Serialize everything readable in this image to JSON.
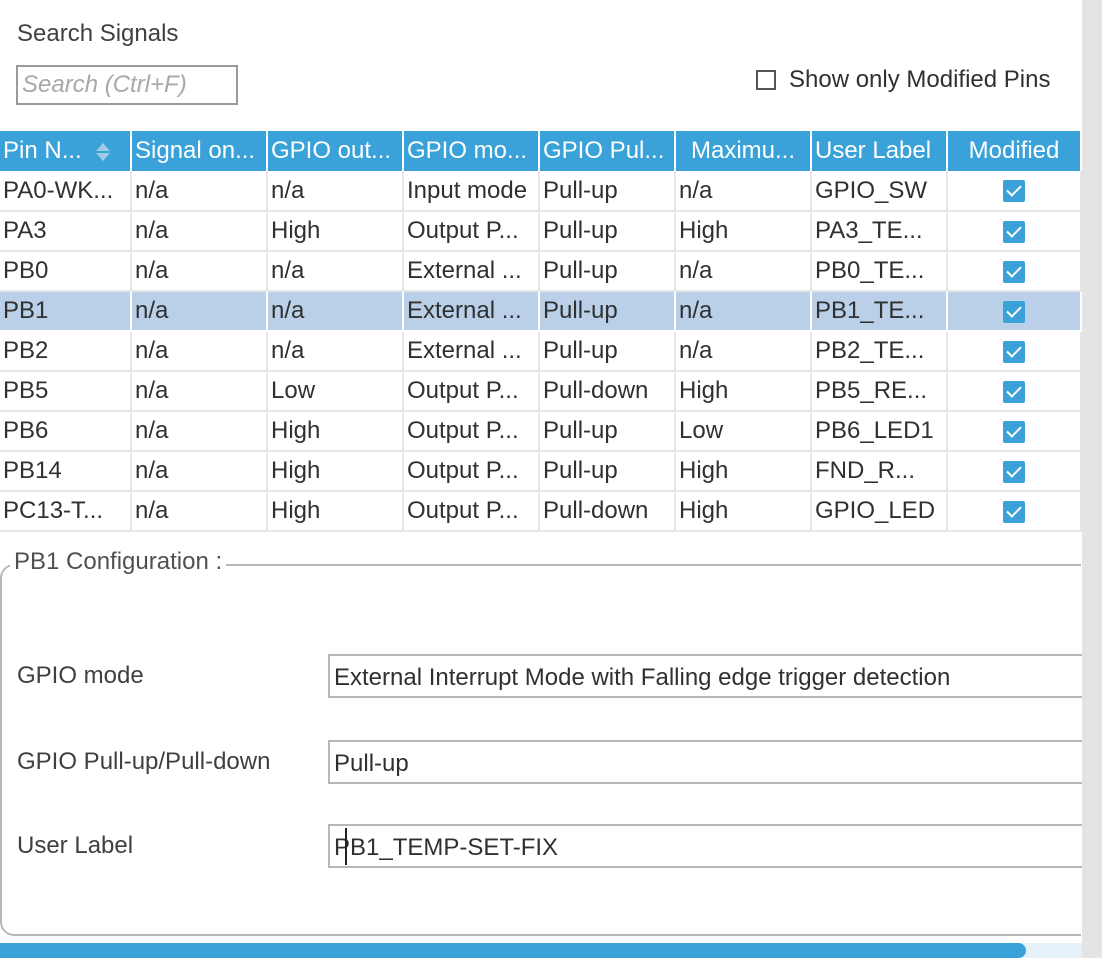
{
  "search": {
    "title": "Search Signals",
    "placeholder": "Search (Ctrl+F)"
  },
  "filter": {
    "show_modified_label": "Show only Modified Pins",
    "checked": false
  },
  "table": {
    "columns": [
      "Pin N...",
      "Signal on...",
      "GPIO out...",
      "GPIO mo...",
      "GPIO Pul...",
      "Maximu...",
      "User Label",
      "Modified"
    ],
    "sorted_column": "Pin N...",
    "selected_row": "PB1",
    "rows": [
      {
        "pin": "PA0-WK...",
        "signal": "n/a",
        "output": "n/a",
        "mode": "Input mode",
        "pull": "Pull-up",
        "max": "n/a",
        "label": "GPIO_SW",
        "modified": true
      },
      {
        "pin": "PA3",
        "signal": "n/a",
        "output": "High",
        "mode": "Output P...",
        "pull": "Pull-up",
        "max": "High",
        "label": "PA3_TE...",
        "modified": true
      },
      {
        "pin": "PB0",
        "signal": "n/a",
        "output": "n/a",
        "mode": "External ...",
        "pull": "Pull-up",
        "max": "n/a",
        "label": "PB0_TE...",
        "modified": true
      },
      {
        "pin": "PB1",
        "signal": "n/a",
        "output": "n/a",
        "mode": "External ...",
        "pull": "Pull-up",
        "max": "n/a",
        "label": "PB1_TE...",
        "modified": true
      },
      {
        "pin": "PB2",
        "signal": "n/a",
        "output": "n/a",
        "mode": "External ...",
        "pull": "Pull-up",
        "max": "n/a",
        "label": "PB2_TE...",
        "modified": true
      },
      {
        "pin": "PB5",
        "signal": "n/a",
        "output": "Low",
        "mode": "Output P...",
        "pull": "Pull-down",
        "max": "High",
        "label": "PB5_RE...",
        "modified": true
      },
      {
        "pin": "PB6",
        "signal": "n/a",
        "output": "High",
        "mode": "Output P...",
        "pull": "Pull-up",
        "max": "Low",
        "label": "PB6_LED1",
        "modified": true
      },
      {
        "pin": "PB14",
        "signal": "n/a",
        "output": "High",
        "mode": "Output P...",
        "pull": "Pull-up",
        "max": "High",
        "label": "FND_R...",
        "modified": true
      },
      {
        "pin": "PC13-T...",
        "signal": "n/a",
        "output": "High",
        "mode": "Output P...",
        "pull": "Pull-down",
        "max": "High",
        "label": "GPIO_LED",
        "modified": true
      }
    ]
  },
  "config": {
    "legend": "PB1 Configuration :",
    "gpio_mode_label": "GPIO mode",
    "gpio_mode_value": "External Interrupt Mode with Falling edge trigger detection",
    "pull_label": "GPIO Pull-up/Pull-down",
    "pull_value": "Pull-up",
    "user_label_label": "User Label",
    "user_label_value": "PB1_TEMP-SET-FIX"
  },
  "colors": {
    "accent": "#3aa2d8",
    "selected_row": "#b9d0e8"
  },
  "icons": {
    "sort": "sort-arrows-icon",
    "check": "checkbox-checked-icon"
  }
}
